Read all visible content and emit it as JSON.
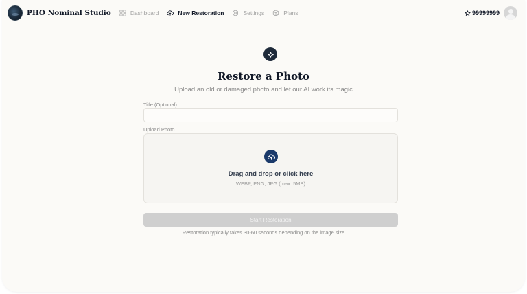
{
  "nav": {
    "brand": "PHO Nominal Studio",
    "items": [
      {
        "label": "Dashboard",
        "icon": "grid-icon",
        "active": false
      },
      {
        "label": "New Restoration",
        "icon": "cloud-upload-icon",
        "active": true
      },
      {
        "label": "Settings",
        "icon": "gear-icon",
        "active": false
      },
      {
        "label": "Plans",
        "icon": "cube-icon",
        "active": false
      }
    ],
    "credits": "99999999",
    "credits_icon": "star-icon"
  },
  "main": {
    "title": "Restore a Photo",
    "subtitle": "Upload an old or damaged photo and let our AI work its magic",
    "title_field": {
      "label": "Title (Optional)",
      "value": "",
      "placeholder": ""
    },
    "upload": {
      "label": "Upload Photo",
      "headline": "Drag and drop or click here",
      "hint": "WEBP, PNG, JPG (max. 5MB)"
    },
    "start_button": "Start Restoration",
    "footnote": "Restoration typically takes 30-60 seconds depending on the image size"
  },
  "colors": {
    "background": "#fbfaf7",
    "accent": "#1b3a6b",
    "hero_icon": "#1e2a3a",
    "button_disabled": "#cfcfcf"
  }
}
